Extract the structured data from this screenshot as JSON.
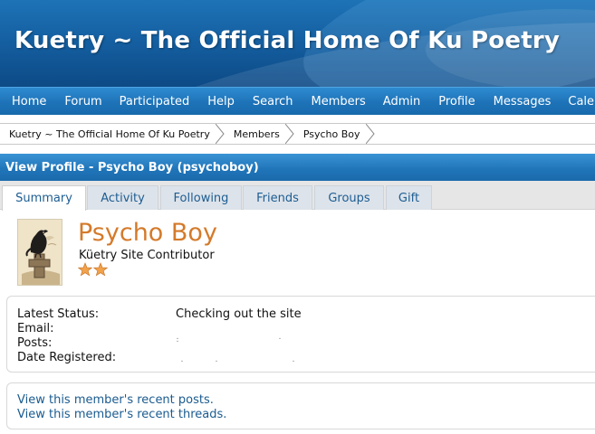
{
  "site": {
    "title": "Kuetry ~ The Official Home Of Ku Poetry"
  },
  "nav": {
    "items": [
      "Home",
      "Forum",
      "Participated",
      "Help",
      "Search",
      "Members",
      "Admin",
      "Profile",
      "Messages",
      "Calendar"
    ]
  },
  "breadcrumb": {
    "items": [
      "Kuetry ~ The Official Home Of Ku Poetry",
      "Members",
      "Psycho Boy"
    ]
  },
  "section": {
    "title": "View Profile - Psycho Boy (psychoboy)"
  },
  "tabs": [
    {
      "label": "Summary",
      "active": true
    },
    {
      "label": "Activity",
      "active": false
    },
    {
      "label": "Following",
      "active": false
    },
    {
      "label": "Friends",
      "active": false
    },
    {
      "label": "Groups",
      "active": false
    },
    {
      "label": "Gift",
      "active": false
    }
  ],
  "profile": {
    "name": "Psycho Boy",
    "rank": "Küetry Site Contributor",
    "star_count": 2,
    "avatar_icon": "crow-on-gravestone-icon"
  },
  "info": {
    "status_label": "Latest Status:",
    "status_value": "Checking out the site",
    "email_label": "Email:",
    "posts_label": "Posts:",
    "registered_label": "Date Registered:"
  },
  "links": {
    "recent_posts": "View this member's recent posts.",
    "recent_threads": "View this member's recent threads."
  },
  "colors": {
    "nav_blue": "#1e73b8",
    "name_orange": "#d47a2a",
    "link_blue": "#1a5b8f",
    "star_orange": "#e88a2c"
  }
}
